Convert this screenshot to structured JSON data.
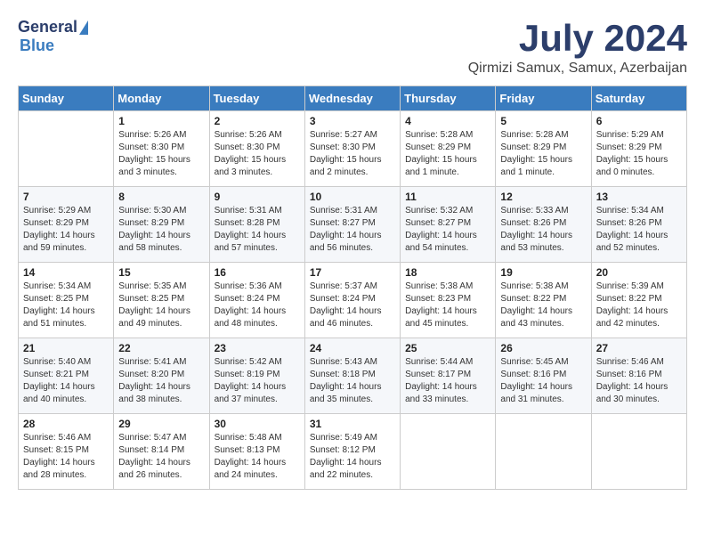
{
  "header": {
    "logo": {
      "general": "General",
      "blue": "Blue"
    },
    "title": "July 2024",
    "location": "Qirmizi Samux, Samux, Azerbaijan"
  },
  "weekdays": [
    "Sunday",
    "Monday",
    "Tuesday",
    "Wednesday",
    "Thursday",
    "Friday",
    "Saturday"
  ],
  "weeks": [
    [
      {
        "day": "",
        "sunrise": "",
        "sunset": "",
        "daylight": ""
      },
      {
        "day": "1",
        "sunrise": "Sunrise: 5:26 AM",
        "sunset": "Sunset: 8:30 PM",
        "daylight": "Daylight: 15 hours and 3 minutes."
      },
      {
        "day": "2",
        "sunrise": "Sunrise: 5:26 AM",
        "sunset": "Sunset: 8:30 PM",
        "daylight": "Daylight: 15 hours and 3 minutes."
      },
      {
        "day": "3",
        "sunrise": "Sunrise: 5:27 AM",
        "sunset": "Sunset: 8:30 PM",
        "daylight": "Daylight: 15 hours and 2 minutes."
      },
      {
        "day": "4",
        "sunrise": "Sunrise: 5:28 AM",
        "sunset": "Sunset: 8:29 PM",
        "daylight": "Daylight: 15 hours and 1 minute."
      },
      {
        "day": "5",
        "sunrise": "Sunrise: 5:28 AM",
        "sunset": "Sunset: 8:29 PM",
        "daylight": "Daylight: 15 hours and 1 minute."
      },
      {
        "day": "6",
        "sunrise": "Sunrise: 5:29 AM",
        "sunset": "Sunset: 8:29 PM",
        "daylight": "Daylight: 15 hours and 0 minutes."
      }
    ],
    [
      {
        "day": "7",
        "sunrise": "Sunrise: 5:29 AM",
        "sunset": "Sunset: 8:29 PM",
        "daylight": "Daylight: 14 hours and 59 minutes."
      },
      {
        "day": "8",
        "sunrise": "Sunrise: 5:30 AM",
        "sunset": "Sunset: 8:29 PM",
        "daylight": "Daylight: 14 hours and 58 minutes."
      },
      {
        "day": "9",
        "sunrise": "Sunrise: 5:31 AM",
        "sunset": "Sunset: 8:28 PM",
        "daylight": "Daylight: 14 hours and 57 minutes."
      },
      {
        "day": "10",
        "sunrise": "Sunrise: 5:31 AM",
        "sunset": "Sunset: 8:27 PM",
        "daylight": "Daylight: 14 hours and 56 minutes."
      },
      {
        "day": "11",
        "sunrise": "Sunrise: 5:32 AM",
        "sunset": "Sunset: 8:27 PM",
        "daylight": "Daylight: 14 hours and 54 minutes."
      },
      {
        "day": "12",
        "sunrise": "Sunrise: 5:33 AM",
        "sunset": "Sunset: 8:26 PM",
        "daylight": "Daylight: 14 hours and 53 minutes."
      },
      {
        "day": "13",
        "sunrise": "Sunrise: 5:34 AM",
        "sunset": "Sunset: 8:26 PM",
        "daylight": "Daylight: 14 hours and 52 minutes."
      }
    ],
    [
      {
        "day": "14",
        "sunrise": "Sunrise: 5:34 AM",
        "sunset": "Sunset: 8:25 PM",
        "daylight": "Daylight: 14 hours and 51 minutes."
      },
      {
        "day": "15",
        "sunrise": "Sunrise: 5:35 AM",
        "sunset": "Sunset: 8:25 PM",
        "daylight": "Daylight: 14 hours and 49 minutes."
      },
      {
        "day": "16",
        "sunrise": "Sunrise: 5:36 AM",
        "sunset": "Sunset: 8:24 PM",
        "daylight": "Daylight: 14 hours and 48 minutes."
      },
      {
        "day": "17",
        "sunrise": "Sunrise: 5:37 AM",
        "sunset": "Sunset: 8:24 PM",
        "daylight": "Daylight: 14 hours and 46 minutes."
      },
      {
        "day": "18",
        "sunrise": "Sunrise: 5:38 AM",
        "sunset": "Sunset: 8:23 PM",
        "daylight": "Daylight: 14 hours and 45 minutes."
      },
      {
        "day": "19",
        "sunrise": "Sunrise: 5:38 AM",
        "sunset": "Sunset: 8:22 PM",
        "daylight": "Daylight: 14 hours and 43 minutes."
      },
      {
        "day": "20",
        "sunrise": "Sunrise: 5:39 AM",
        "sunset": "Sunset: 8:22 PM",
        "daylight": "Daylight: 14 hours and 42 minutes."
      }
    ],
    [
      {
        "day": "21",
        "sunrise": "Sunrise: 5:40 AM",
        "sunset": "Sunset: 8:21 PM",
        "daylight": "Daylight: 14 hours and 40 minutes."
      },
      {
        "day": "22",
        "sunrise": "Sunrise: 5:41 AM",
        "sunset": "Sunset: 8:20 PM",
        "daylight": "Daylight: 14 hours and 38 minutes."
      },
      {
        "day": "23",
        "sunrise": "Sunrise: 5:42 AM",
        "sunset": "Sunset: 8:19 PM",
        "daylight": "Daylight: 14 hours and 37 minutes."
      },
      {
        "day": "24",
        "sunrise": "Sunrise: 5:43 AM",
        "sunset": "Sunset: 8:18 PM",
        "daylight": "Daylight: 14 hours and 35 minutes."
      },
      {
        "day": "25",
        "sunrise": "Sunrise: 5:44 AM",
        "sunset": "Sunset: 8:17 PM",
        "daylight": "Daylight: 14 hours and 33 minutes."
      },
      {
        "day": "26",
        "sunrise": "Sunrise: 5:45 AM",
        "sunset": "Sunset: 8:16 PM",
        "daylight": "Daylight: 14 hours and 31 minutes."
      },
      {
        "day": "27",
        "sunrise": "Sunrise: 5:46 AM",
        "sunset": "Sunset: 8:16 PM",
        "daylight": "Daylight: 14 hours and 30 minutes."
      }
    ],
    [
      {
        "day": "28",
        "sunrise": "Sunrise: 5:46 AM",
        "sunset": "Sunset: 8:15 PM",
        "daylight": "Daylight: 14 hours and 28 minutes."
      },
      {
        "day": "29",
        "sunrise": "Sunrise: 5:47 AM",
        "sunset": "Sunset: 8:14 PM",
        "daylight": "Daylight: 14 hours and 26 minutes."
      },
      {
        "day": "30",
        "sunrise": "Sunrise: 5:48 AM",
        "sunset": "Sunset: 8:13 PM",
        "daylight": "Daylight: 14 hours and 24 minutes."
      },
      {
        "day": "31",
        "sunrise": "Sunrise: 5:49 AM",
        "sunset": "Sunset: 8:12 PM",
        "daylight": "Daylight: 14 hours and 22 minutes."
      },
      {
        "day": "",
        "sunrise": "",
        "sunset": "",
        "daylight": ""
      },
      {
        "day": "",
        "sunrise": "",
        "sunset": "",
        "daylight": ""
      },
      {
        "day": "",
        "sunrise": "",
        "sunset": "",
        "daylight": ""
      }
    ]
  ]
}
